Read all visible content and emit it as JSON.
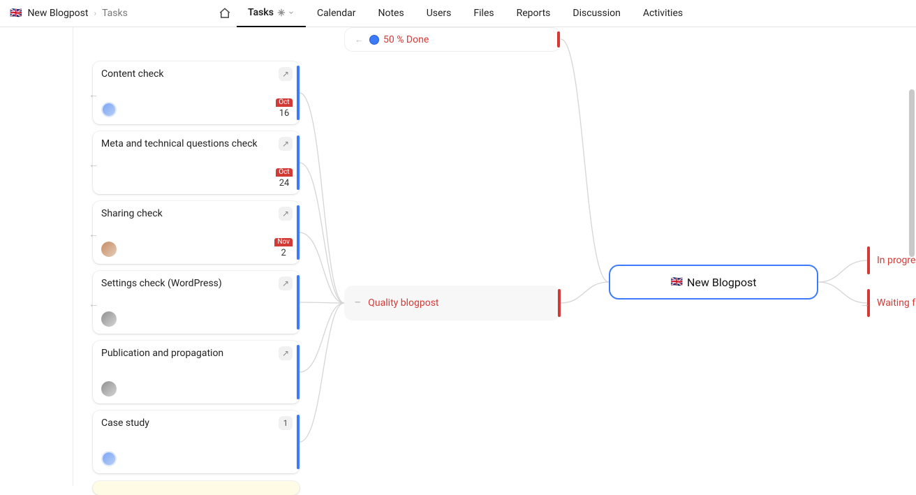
{
  "breadcrumb": {
    "flag": "🇬🇧",
    "title": "New Blogpost",
    "sub": "Tasks"
  },
  "nav": {
    "home": "home",
    "items": [
      "Tasks",
      "Calendar",
      "Notes",
      "Users",
      "Files",
      "Reports",
      "Discussion",
      "Activities"
    ],
    "active_index": 0
  },
  "columns": {
    "tasks": [
      {
        "title": "Content check",
        "avatar": "blue",
        "date_month": "Oct",
        "date_day": "16",
        "external": true
      },
      {
        "title": "Meta and technical questions check",
        "avatar": null,
        "date_month": "Oct",
        "date_day": "24",
        "external": true
      },
      {
        "title": "Sharing check",
        "avatar": "plain1",
        "date_month": "Nov",
        "date_day": "2",
        "external": true
      },
      {
        "title": "Settings check (WordPress)",
        "avatar": "plain2",
        "external": true
      },
      {
        "title": "Publication and propagation",
        "avatar": "plain2",
        "external": true
      },
      {
        "title": "Case study",
        "avatar": "blue",
        "count": "1"
      }
    ],
    "mid_top": {
      "text": "50 % Done",
      "icon": "status-dot"
    },
    "mid_main": {
      "text": "Quality blogpost"
    },
    "root": {
      "flag": "🇬🇧",
      "title": "New Blogpost"
    },
    "right": [
      {
        "text": "In progre"
      },
      {
        "text": "Waiting f"
      }
    ]
  }
}
